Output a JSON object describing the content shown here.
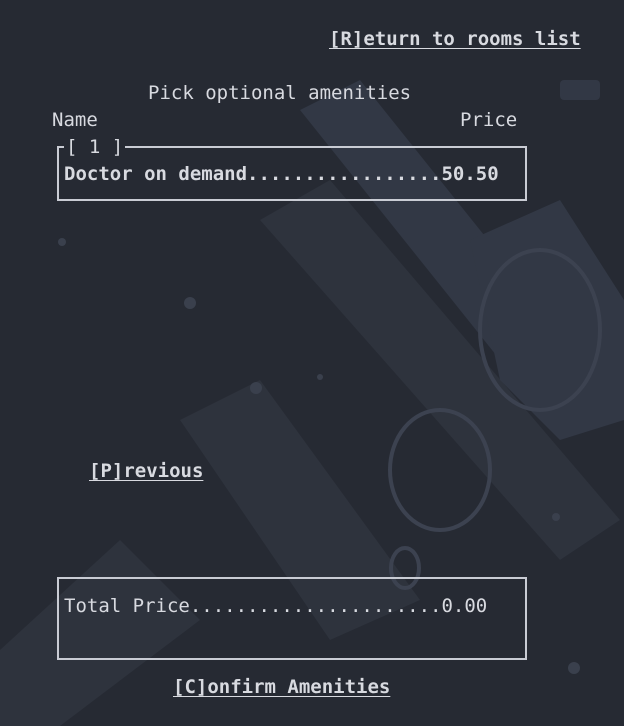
{
  "nav": {
    "return_label": "[R]eturn to rooms list"
  },
  "amenities": {
    "heading": "Pick optional amenities",
    "col_name": "Name",
    "col_price": "Price",
    "page_indicator": "[ 1 ]",
    "items": [
      {
        "line": "Doctor on demand.................50.50"
      }
    ]
  },
  "pagination": {
    "previous_label": "[P]revious"
  },
  "total": {
    "line": "Total Price......................0.00"
  },
  "actions": {
    "confirm_label": "[C]onfirm Amenities"
  }
}
